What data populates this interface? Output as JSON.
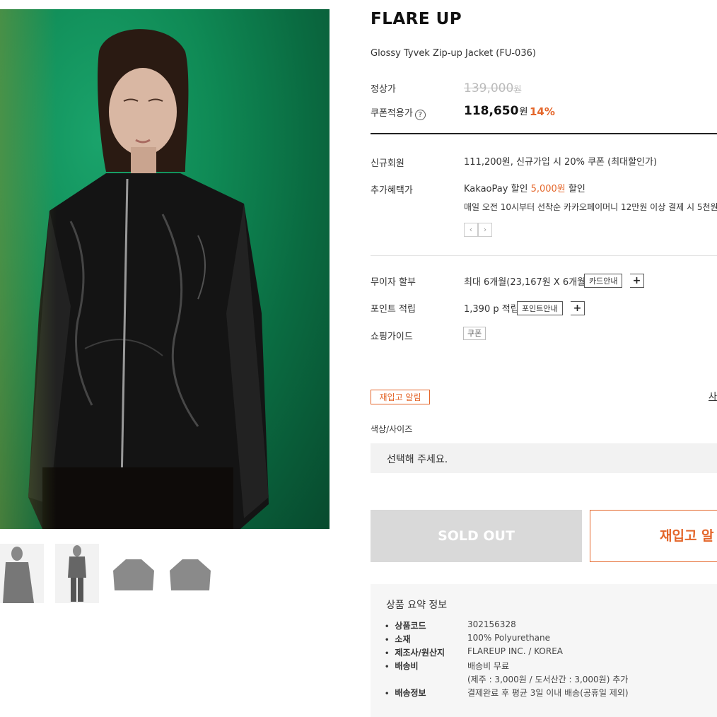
{
  "product": {
    "brand": "FLARE UP",
    "name": "Glossy Tyvek Zip-up Jacket (FU-036)"
  },
  "pricing": {
    "regular_label": "정상가",
    "regular_price": "139,000",
    "regular_unit": "원",
    "coupon_label": "쿠폰적용가",
    "help_icon": "?",
    "coupon_price": "118,650",
    "coupon_unit": "원",
    "discount": "14%"
  },
  "benefits": {
    "new_member_label": "신규회원",
    "new_member_value": "111,200원, 신규가입 시 20% 쿠폰 (최대할인가)",
    "extra_label": "추가혜택가",
    "kakao_prefix": "KakaoPay 할인",
    "kakao_amount": "5,000원",
    "kakao_suffix": "할인",
    "kakao_detail": "매일 오전 10시부터 선착순 카카오페이머니 12만원 이상 결제 시 5천원",
    "prev": "‹",
    "next": "›"
  },
  "info": {
    "installment_label": "무이자 할부",
    "installment_value": "최대 6개월(23,167원 X 6개월)",
    "card_button": "카드안내",
    "points_label": "포인트 적립",
    "points_value": "1,390 p 적립",
    "points_button": "포인트안내",
    "plus": "+",
    "guide_label": "쇼핑가이드",
    "guide_tag": "쿠폰"
  },
  "options": {
    "restock_badge": "재입고 알림",
    "cut_link": "사",
    "option_label": "색상/사이즈",
    "select_placeholder": "선택해 주세요."
  },
  "actions": {
    "soldout": "SOLD OUT",
    "restock": "재입고 알"
  },
  "summary": {
    "title": "상품 요약 정보",
    "rows": [
      {
        "k": "상품코드",
        "v": "302156328"
      },
      {
        "k": "소재",
        "v": "100% Polyurethane"
      },
      {
        "k": "제조사/원산지",
        "v": "FLAREUP INC. / KOREA"
      },
      {
        "k": "배송비",
        "v": "배송비 무료"
      },
      {
        "k": "",
        "v": "(제주 : 3,000원 / 도서산간 : 3,000원) 추가"
      },
      {
        "k": "배송정보",
        "v": "결제완료 후 평균 3일 이내 배송(공휴일 제외)"
      }
    ]
  },
  "colors": {
    "accent": "#e4662a",
    "soldout_bg": "#d9d9d9",
    "photo_green": "#0f8a55"
  }
}
